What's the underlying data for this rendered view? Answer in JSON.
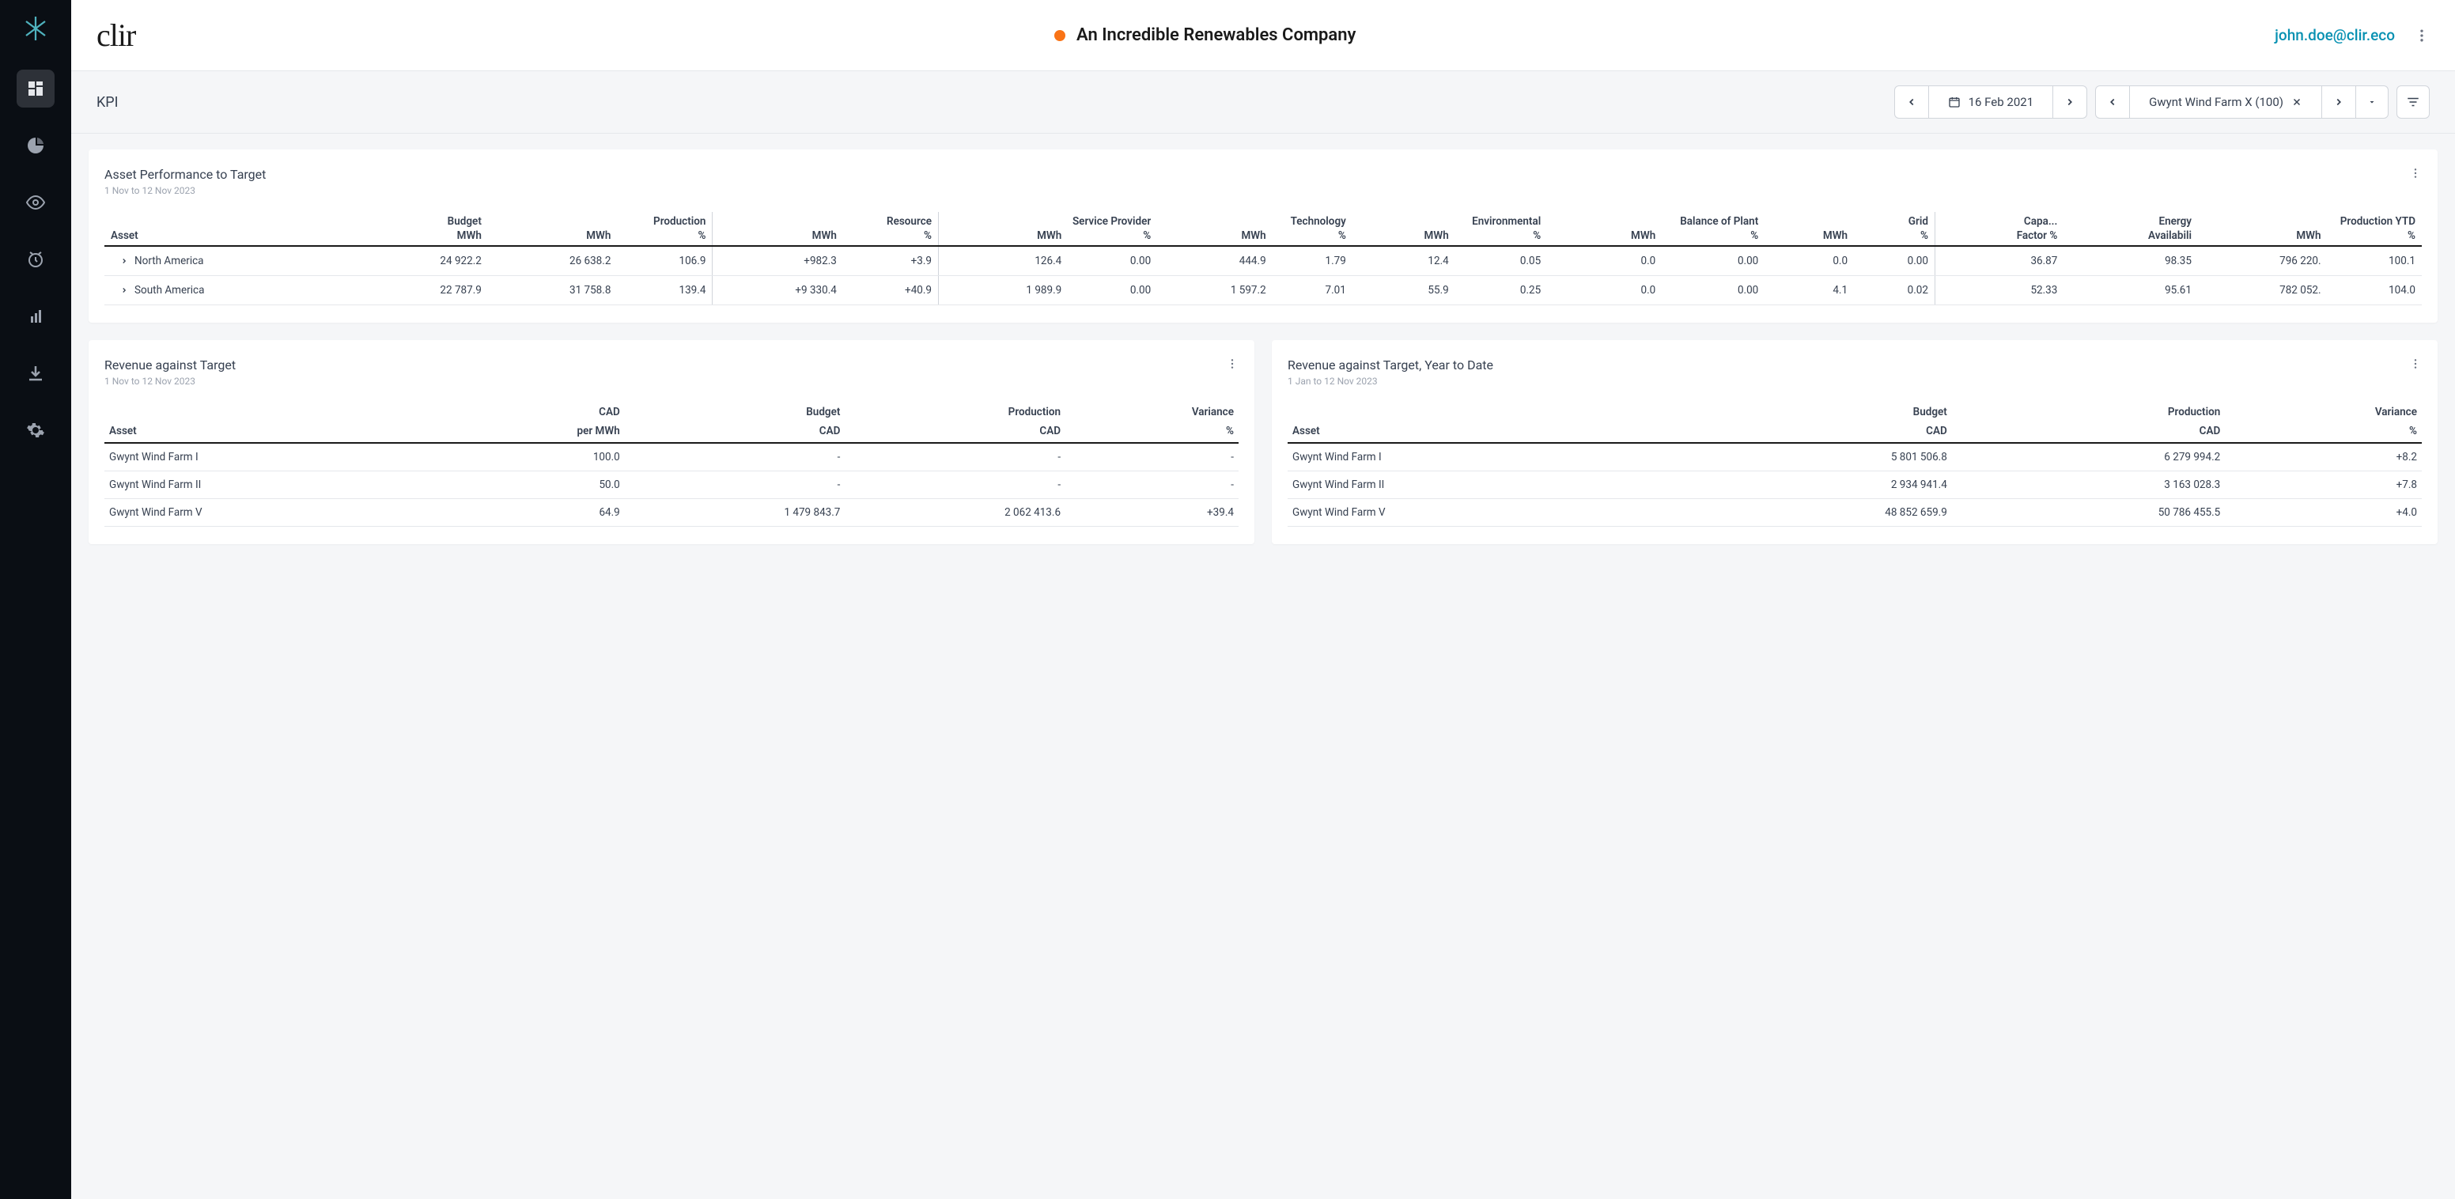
{
  "header": {
    "company": "An Incredible Renewables Company",
    "user": "john.doe@clir.eco",
    "logo": "clir"
  },
  "subheader": {
    "title": "KPI",
    "date": "16 Feb 2021",
    "asset_filter": "Gwynt Wind Farm X (100)"
  },
  "perf": {
    "title": "Asset Performance to Target",
    "range": "1 Nov to 12 Nov 2023",
    "groups": {
      "asset": "Asset",
      "budget": "Budget",
      "production": "Production",
      "resource": "Resource",
      "service": "Service Provider",
      "tech": "Technology",
      "env": "Environmental",
      "bop": "Balance of Plant",
      "grid": "Grid",
      "cap": "Capa...",
      "energy": "Energy",
      "pytd": "Production YTD"
    },
    "units": {
      "mwh": "MWh",
      "pct": "%",
      "cap": "Factor %",
      "energy": "Availabili"
    },
    "rows": [
      {
        "asset": "North America",
        "budget_mwh": "24 922.2",
        "prod_mwh": "26 638.2",
        "prod_pct": "106.9",
        "res_mwh": "+982.3",
        "res_pct": "+3.9",
        "sp_mwh": "126.4",
        "sp_pct": "0.00",
        "tech_mwh": "444.9",
        "tech_pct": "1.79",
        "env_mwh": "12.4",
        "env_pct": "0.05",
        "bop_mwh": "0.0",
        "bop_pct": "0.00",
        "grid_mwh": "0.0",
        "grid_pct": "0.00",
        "cap": "36.87",
        "energy": "98.35",
        "pytd_mwh": "796 220.",
        "pytd_pct": "100.1"
      },
      {
        "asset": "South America",
        "budget_mwh": "22 787.9",
        "prod_mwh": "31 758.8",
        "prod_pct": "139.4",
        "res_mwh": "+9 330.4",
        "res_pct": "+40.9",
        "sp_mwh": "1 989.9",
        "sp_pct": "0.00",
        "tech_mwh": "1 597.2",
        "tech_pct": "7.01",
        "env_mwh": "55.9",
        "env_pct": "0.25",
        "bop_mwh": "0.0",
        "bop_pct": "0.00",
        "grid_mwh": "4.1",
        "grid_pct": "0.02",
        "cap": "52.33",
        "energy": "95.61",
        "pytd_mwh": "782 052.",
        "pytd_pct": "104.0"
      }
    ]
  },
  "rev": {
    "title": "Revenue against Target",
    "range": "1 Nov to 12 Nov 2023",
    "headers": {
      "asset": "Asset",
      "cad_mwh": "CAD",
      "cad_mwh2": "per MWh",
      "budget": "Budget",
      "cad": "CAD",
      "production": "Production",
      "variance": "Variance",
      "pct": "%"
    },
    "rows": [
      {
        "asset": "Gwynt Wind Farm I",
        "cad_mwh": "100.0",
        "budget": "-",
        "production": "-",
        "variance": "-"
      },
      {
        "asset": "Gwynt Wind Farm II",
        "cad_mwh": "50.0",
        "budget": "-",
        "production": "-",
        "variance": "-"
      },
      {
        "asset": "Gwynt Wind Farm V",
        "cad_mwh": "64.9",
        "budget": "1 479 843.7",
        "production": "2 062 413.6",
        "variance": "+39.4"
      }
    ]
  },
  "revytd": {
    "title": "Revenue against Target, Year to Date",
    "range": "1 Jan to 12 Nov 2023",
    "headers": {
      "asset": "Asset",
      "budget": "Budget",
      "cad": "CAD",
      "production": "Production",
      "variance": "Variance",
      "pct": "%"
    },
    "rows": [
      {
        "asset": "Gwynt Wind Farm I",
        "budget": "5 801 506.8",
        "production": "6 279 994.2",
        "variance": "+8.2"
      },
      {
        "asset": "Gwynt Wind Farm II",
        "budget": "2 934 941.4",
        "production": "3 163 028.3",
        "variance": "+7.8"
      },
      {
        "asset": "Gwynt Wind Farm V",
        "budget": "48 852 659.9",
        "production": "50 786 455.5",
        "variance": "+4.0"
      }
    ]
  }
}
